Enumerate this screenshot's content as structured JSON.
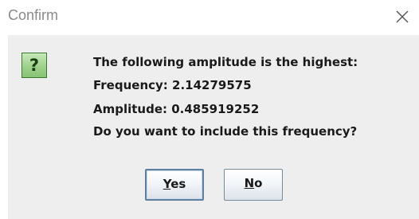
{
  "window": {
    "title": "Confirm"
  },
  "message": {
    "line1": "The following amplitude is the highest:",
    "line2": "Frequency:  2.14279575",
    "line3": "Amplitude:  0.485919252",
    "line4": "Do you want to include this frequency?"
  },
  "buttons": {
    "yes": {
      "mnemonic": "Y",
      "rest": "es"
    },
    "no": {
      "mnemonic": "N",
      "rest": "o"
    }
  },
  "icons": {
    "close": "close-icon",
    "question": "question-icon",
    "question_glyph": "?"
  },
  "colors": {
    "icon_green": "#9fd18c",
    "dialog_body": "#eeeeee",
    "focus_border": "#5f7f9e"
  }
}
